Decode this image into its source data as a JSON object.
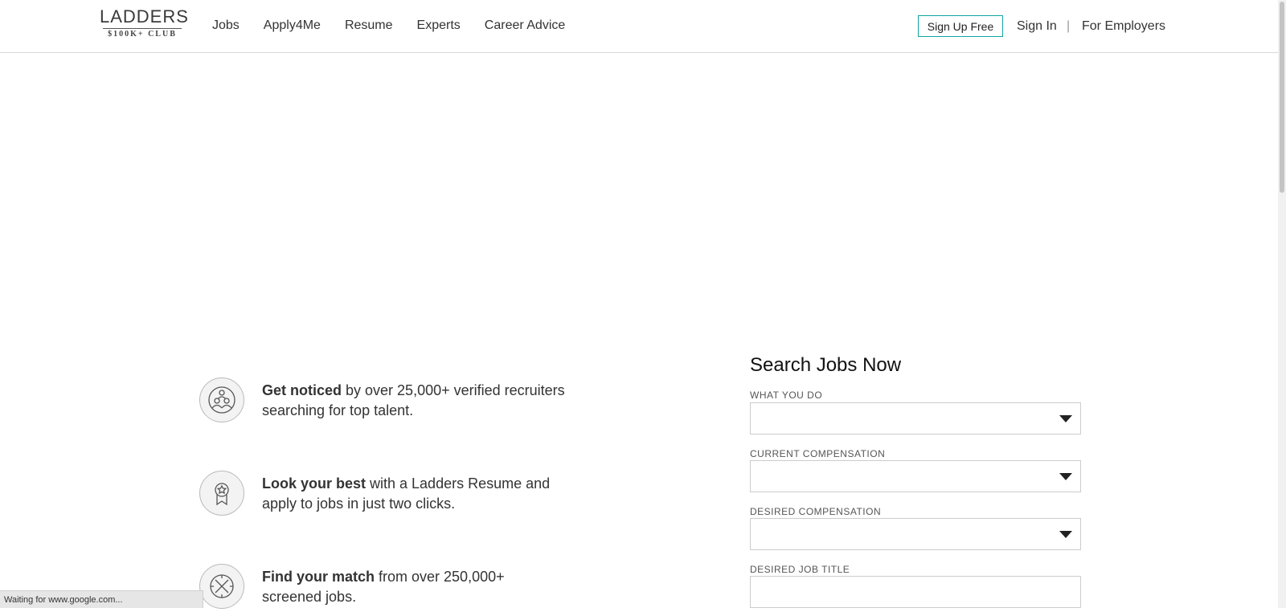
{
  "header": {
    "logo_word": "LADDERS",
    "logo_sub": "$100K+ CLUB",
    "nav": [
      "Jobs",
      "Apply4Me",
      "Resume",
      "Experts",
      "Career Advice"
    ],
    "signup_label": "Sign Up Free",
    "signin_label": "Sign In",
    "separator": "|",
    "employers_label": "For Employers"
  },
  "features": [
    {
      "icon": "people-icon",
      "bold": "Get noticed",
      "rest": " by over 25,000+ verified recruiters searching for top talent."
    },
    {
      "icon": "award-icon",
      "bold": "Look your best",
      "rest": " with a Ladders Resume and apply to jobs in just two clicks."
    },
    {
      "icon": "compass-icon",
      "bold": "Find your match",
      "rest": " from over 250,000+ screened jobs."
    }
  ],
  "search": {
    "title": "Search Jobs Now",
    "what_you_do_label": "WHAT YOU DO",
    "current_comp_label": "CURRENT COMPENSATION",
    "desired_comp_label": "DESIRED COMPENSATION",
    "desired_title_label": "DESIRED JOB TITLE"
  },
  "status_bar": "Waiting for www.google.com..."
}
